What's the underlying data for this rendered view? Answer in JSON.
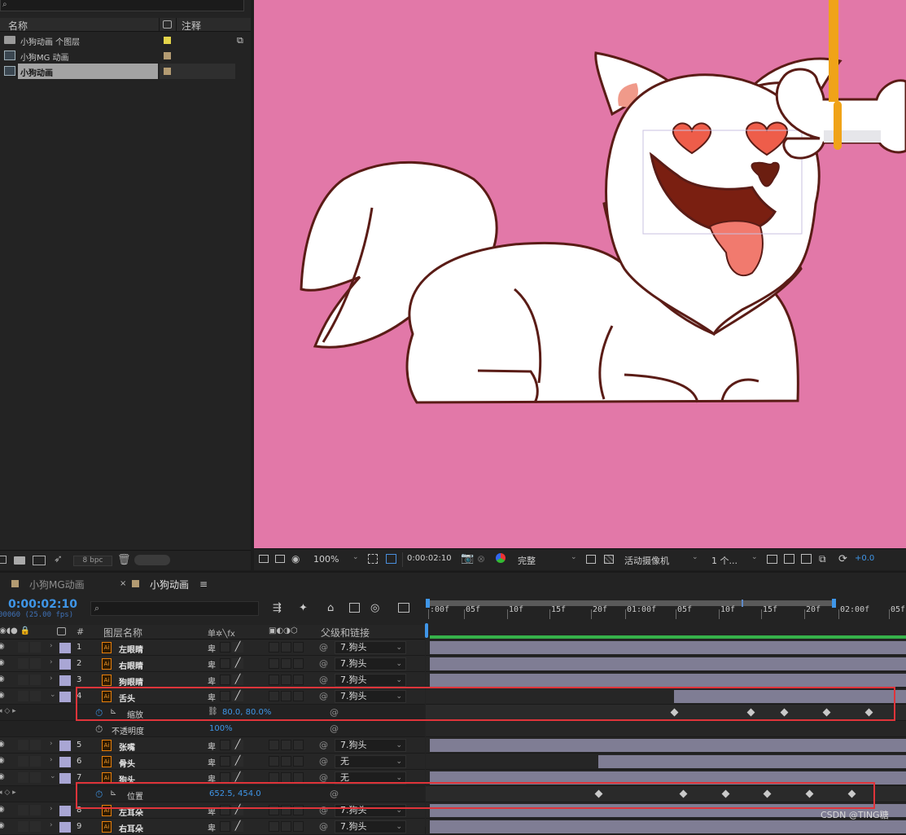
{
  "project": {
    "header": {
      "name": "名称",
      "comment": "注释"
    },
    "items": [
      {
        "label": "小狗动画 个图层",
        "kind": "folder",
        "color": "#e4d44a"
      },
      {
        "label": "小狗MG 动画",
        "kind": "comp",
        "color": "#b39b72"
      },
      {
        "label": "小狗动画",
        "kind": "comp",
        "color": "#b39b72",
        "selected": true
      }
    ],
    "bpc": "8 bpc"
  },
  "viewer": {
    "zoom": "100%",
    "timecode": "0:00:02:10",
    "quality": "完整",
    "camera": "活动摄像机",
    "views": "1 个...",
    "exposure": "+0.0",
    "background": "#e278a8"
  },
  "timeline": {
    "tabs": [
      {
        "label": "小狗MG动画",
        "active": false
      },
      {
        "label": "小狗动画",
        "active": true
      }
    ],
    "timecode": "0:00:02:10",
    "frame_info": "00060 (25.00 fps)",
    "columns": {
      "num": "#",
      "layer_name": "图层名称",
      "switches": "单✲╲fx",
      "parent": "父级和链接"
    },
    "ruler": [
      ":00f",
      "05f",
      "10f",
      "15f",
      "20f",
      "01:00f",
      "05f",
      "10f",
      "15f",
      "20f",
      "02:00f",
      "05f"
    ],
    "rows": [
      {
        "type": "layer",
        "num": "1",
        "name": "左眼睛",
        "parent": "7.狗头",
        "bar_start": 0.0
      },
      {
        "type": "layer",
        "num": "2",
        "name": "右眼睛",
        "parent": "7.狗头",
        "bar_start": 0.0
      },
      {
        "type": "layer",
        "num": "3",
        "name": "狗眼睛",
        "parent": "7.狗头",
        "bar_start": 0.0
      },
      {
        "type": "layer",
        "num": "4",
        "name": "舌头",
        "parent": "7.狗头",
        "bar_start": 1.16,
        "expanded": true
      },
      {
        "type": "prop",
        "name": "缩放",
        "value": "80.0, 80.0%",
        "keyframes": [
          1.16,
          1.52,
          1.68,
          1.88,
          2.08
        ]
      },
      {
        "type": "prop",
        "name": "不透明度",
        "value": "100%"
      },
      {
        "type": "layer",
        "num": "5",
        "name": "张嘴",
        "parent": "7.狗头",
        "bar_start": 0.0
      },
      {
        "type": "layer",
        "num": "6",
        "name": "骨头",
        "parent": "无",
        "bar_start": 0.8
      },
      {
        "type": "layer",
        "num": "7",
        "name": "狗头",
        "parent": "无",
        "bar_start": 0.0,
        "expanded": true
      },
      {
        "type": "prop",
        "name": "位置",
        "value": "652.5, 454.0",
        "keyframes": [
          0.8,
          1.2,
          1.4,
          1.6,
          1.8,
          2.0
        ]
      },
      {
        "type": "layer",
        "num": "8",
        "name": "左耳朵",
        "parent": "7.狗头",
        "bar_start": 0.0
      },
      {
        "type": "layer",
        "num": "9",
        "name": "右耳朵",
        "parent": "7.狗头",
        "bar_start": 0.0
      }
    ]
  },
  "watermark": "CSDN @TING糖"
}
